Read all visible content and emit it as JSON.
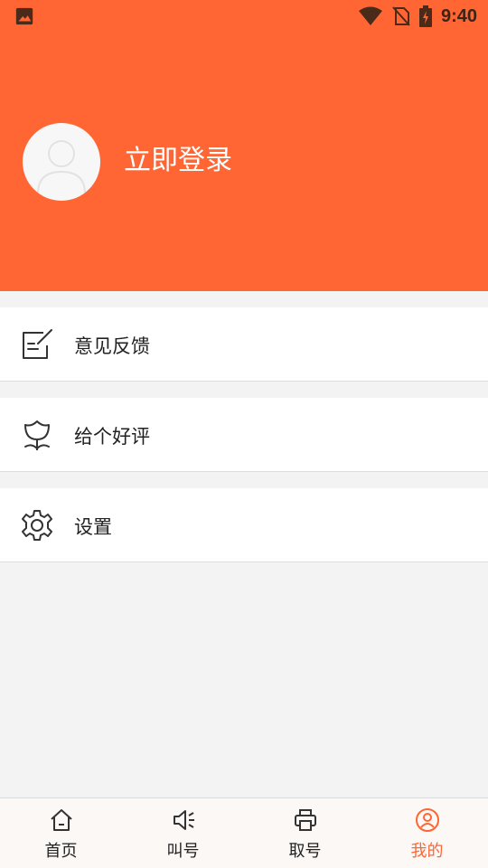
{
  "status_bar": {
    "time": "9:40",
    "icons": [
      "image-icon",
      "wifi-icon",
      "no-sim-icon",
      "battery-charging-icon"
    ]
  },
  "profile": {
    "login_label": "立即登录",
    "avatar_icon": "person-icon"
  },
  "menu": {
    "items": [
      {
        "label": "意见反馈",
        "icon": "feedback-icon"
      },
      {
        "label": "给个好评",
        "icon": "flower-icon"
      },
      {
        "label": "设置",
        "icon": "gear-icon"
      }
    ]
  },
  "tabbar": {
    "tabs": [
      {
        "label": "首页",
        "icon": "home-icon"
      },
      {
        "label": "叫号",
        "icon": "speaker-icon"
      },
      {
        "label": "取号",
        "icon": "printer-icon"
      },
      {
        "label": "我的",
        "icon": "user-circle-icon",
        "active": true
      }
    ]
  },
  "colors": {
    "accent": "#ff6633",
    "background": "#f3f3f3",
    "text": "#222222"
  }
}
